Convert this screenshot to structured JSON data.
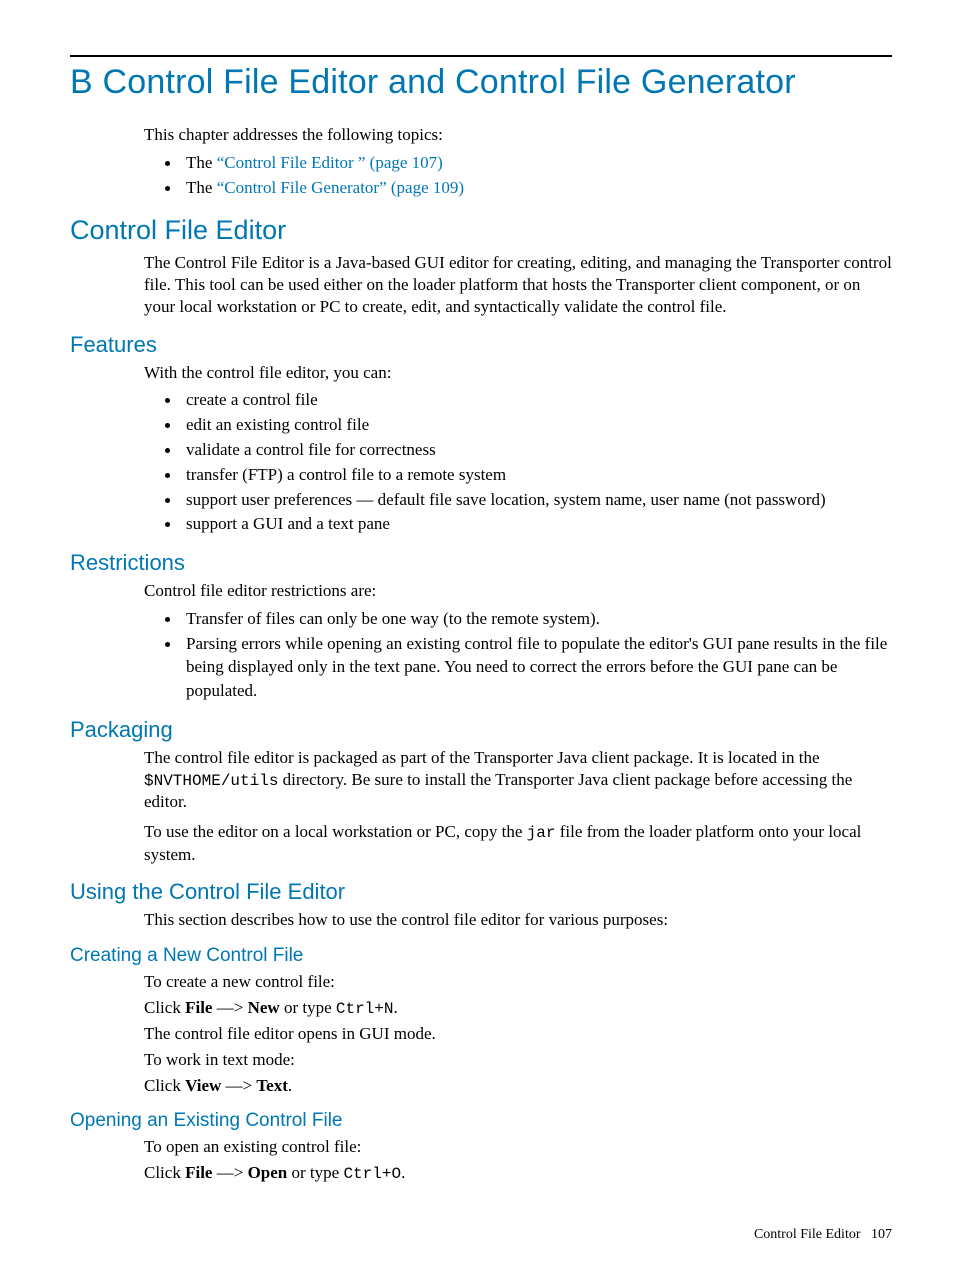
{
  "title": "B Control File Editor and Control File Generator",
  "intro": {
    "lead": "This chapter addresses the following topics:",
    "items": [
      {
        "prefix": "The ",
        "link": "“Control File Editor ” (page 107)"
      },
      {
        "prefix": "The ",
        "link": "“Control File Generator” (page 109)"
      }
    ]
  },
  "cfe": {
    "heading": "Control File Editor",
    "para": "The Control File Editor is a Java-based GUI editor for creating, editing, and managing the Transporter control file. This tool can be used either on the loader platform that hosts the Transporter client component, or on your local workstation or PC to create, edit, and syntactically validate the control file."
  },
  "features": {
    "heading": "Features",
    "lead": "With the control file editor, you can:",
    "items": [
      "create a control file",
      "edit an existing control file",
      "validate a control file for correctness",
      "transfer (FTP) a control file to a remote system",
      "support user preferences — default file save location, system name, user name (not password)",
      "support a GUI and a text pane"
    ]
  },
  "restrictions": {
    "heading": "Restrictions",
    "lead": "Control file editor restrictions are:",
    "items": [
      "Transfer of files can only be one way (to the remote system).",
      "Parsing errors while opening an existing control file to populate the editor's GUI pane results in the file being displayed only in the text pane. You need to correct the errors before the GUI pane can be populated."
    ]
  },
  "packaging": {
    "heading": "Packaging",
    "p1a": "The control file editor is packaged as part of the Transporter Java client package. It is located in the ",
    "code1": "$NVTHOME/utils",
    "p1b": " directory. Be sure to install the Transporter Java client package before accessing the editor.",
    "p2a": "To use the editor on a local workstation or PC, copy the ",
    "code2": "jar",
    "p2b": " file from the loader platform onto your local system."
  },
  "using": {
    "heading": "Using the Control File Editor",
    "para": "This section describes how to use the control file editor for various purposes:"
  },
  "creating": {
    "heading": "Creating a New Control File",
    "l1": "To create a new control file:",
    "l2": {
      "pre": "Click ",
      "b1": "File",
      "mid": " —> ",
      "b2": "New",
      "post": " or type ",
      "code": "Ctrl+N",
      "end": "."
    },
    "l3": "The control file editor opens in GUI mode.",
    "l4": "To work in text mode:",
    "l5": {
      "pre": "Click ",
      "b1": "View",
      "mid": " —> ",
      "b2": "Text",
      "end": "."
    }
  },
  "opening": {
    "heading": "Opening an Existing Control File",
    "l1": "To open an existing control file:",
    "l2": {
      "pre": "Click ",
      "b1": "File",
      "mid": " —> ",
      "b2": "Open",
      "post": " or type ",
      "code": "Ctrl+O",
      "end": "."
    }
  },
  "footer": {
    "label": "Control File Editor",
    "page": "107"
  }
}
